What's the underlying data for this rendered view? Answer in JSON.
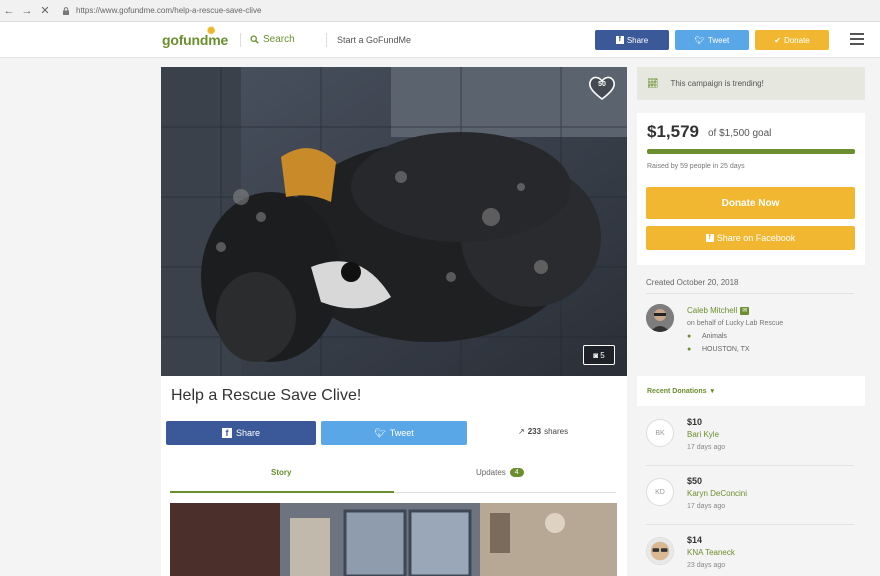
{
  "browser": {
    "url": "https://www.gofundme.com/help-a-rescue-save-clive"
  },
  "header": {
    "logo": "gofundme",
    "search_label": "Search",
    "start_label": "Start a GoFundMe",
    "share_label": "Share",
    "tweet_label": "Tweet",
    "donate_label": "Donate"
  },
  "campaign": {
    "hearts": "50",
    "photo_count": "5",
    "title": "Help a Rescue Save Clive!",
    "share_label": "Share",
    "tweet_label": "Tweet",
    "shares_count": "233",
    "shares_label": "shares",
    "tabs": {
      "story": "Story",
      "updates": "Updates",
      "updates_count": "4"
    }
  },
  "sidebar": {
    "trending": "This campaign is trending!",
    "raised": "$1,579",
    "goal": "of $1,500 goal",
    "progress_fraction": 1.0,
    "raised_by": "Raised by 59 people in 25 days",
    "donate_now": "Donate Now",
    "share_facebook": "Share on Facebook",
    "created": "Created October 20, 2018",
    "organizer": {
      "name": "Caleb Mitchell",
      "behalf": "on behalf of Lucky Lab Rescue",
      "category": "Animals",
      "location": "HOUSTON, TX"
    },
    "recent_label": "Recent Donations",
    "donations": [
      {
        "initials": "BK",
        "amount": "$10",
        "name": "Bari Kyle",
        "days": "17 days ago"
      },
      {
        "initials": "KD",
        "amount": "$50",
        "name": "Karyn DeConcini",
        "days": "17 days ago"
      },
      {
        "initials": "",
        "amount": "$14",
        "name": "KNA Teaneck",
        "days": "23 days ago"
      }
    ]
  },
  "colors": {
    "brand_green": "#6b8f2f",
    "facebook_blue": "#3b5998",
    "twitter_blue": "#5aa7e8",
    "donate_yellow": "#f2b731"
  }
}
